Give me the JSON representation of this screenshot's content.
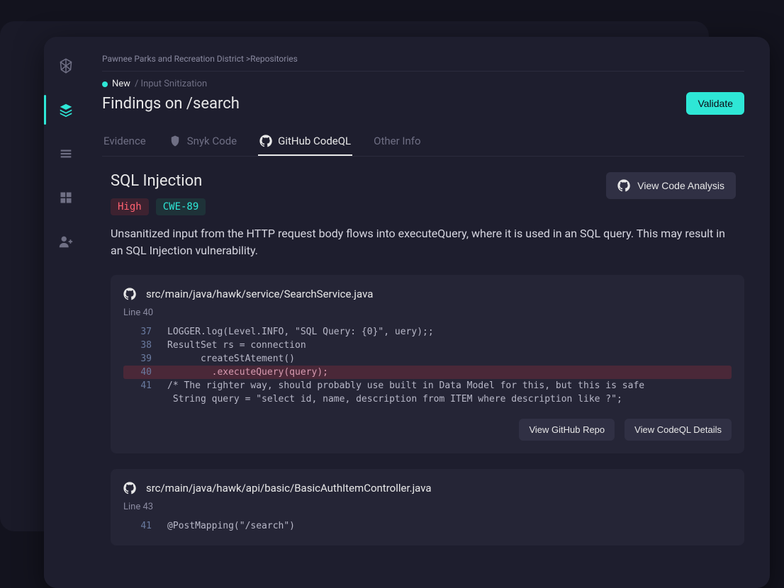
{
  "breadcrumb": "Pawnee Parks and Recreation District >Repositories",
  "status": {
    "new": "New",
    "sep": " / ",
    "path": "Input Snitization"
  },
  "page_title": "Findings on /search",
  "validate_label": "Validate",
  "tabs": [
    {
      "label": "Evidence",
      "icon": null
    },
    {
      "label": "Snyk Code",
      "icon": "snyk"
    },
    {
      "label": "GitHub CodeQL",
      "icon": "github",
      "active": true
    },
    {
      "label": "Other Info",
      "icon": null
    }
  ],
  "finding": {
    "title": "SQL Injection",
    "severity": "High",
    "cwe": "CWE-89",
    "analysis_btn": "View Code Analysis",
    "description": "Unsanitized input from the HTTP request body flows into executeQuery, where it is used in an SQL query. This may result in an SQL Injection vulnerability."
  },
  "blocks": [
    {
      "file": "src/main/java/hawk/service/SearchService.java",
      "line_label": "Line 40",
      "view_repo": "View GitHub Repo",
      "view_details": "View CodeQL Details",
      "lines": [
        {
          "n": "37",
          "c": "LOGGER.log(Level.INFO, \"SQL Query: {0}\", uery);;"
        },
        {
          "n": "38",
          "c": "ResultSet rs = connection"
        },
        {
          "n": "39",
          "c": "      createStAtement()"
        },
        {
          "n": "40",
          "c": "        .executeQuery(query);",
          "hl": true
        },
        {
          "n": "41",
          "c": "/* The righter way, should probably use built in Data Model for this, but this is safe"
        },
        {
          "n": "",
          "c": " String query = \"select id, name, description from ITEM where description like ?\";"
        }
      ]
    },
    {
      "file": "src/main/java/hawk/api/basic/BasicAuthItemController.java",
      "line_label": "Line 43",
      "lines": [
        {
          "n": "41",
          "c": "@PostMapping(\"/search\")"
        }
      ]
    }
  ]
}
